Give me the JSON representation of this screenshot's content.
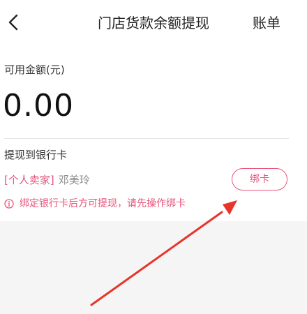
{
  "header": {
    "title": "门店货款余额提现",
    "bill_label": "账单"
  },
  "balance": {
    "label": "可用金额(元)",
    "amount": "0.00"
  },
  "withdraw": {
    "label": "提现到银行卡",
    "seller_tag": "[个人卖家]",
    "seller_name": "邓美玲",
    "bind_label": "绑卡",
    "notice": "绑定银行卡后方可提现，请先操作绑卡"
  },
  "colors": {
    "accent": "#e8537b",
    "annotation_arrow": "#e8342a",
    "background": "#f5f5f5"
  },
  "icons": {
    "back": "chevron-left-icon",
    "notice": "info-icon"
  }
}
